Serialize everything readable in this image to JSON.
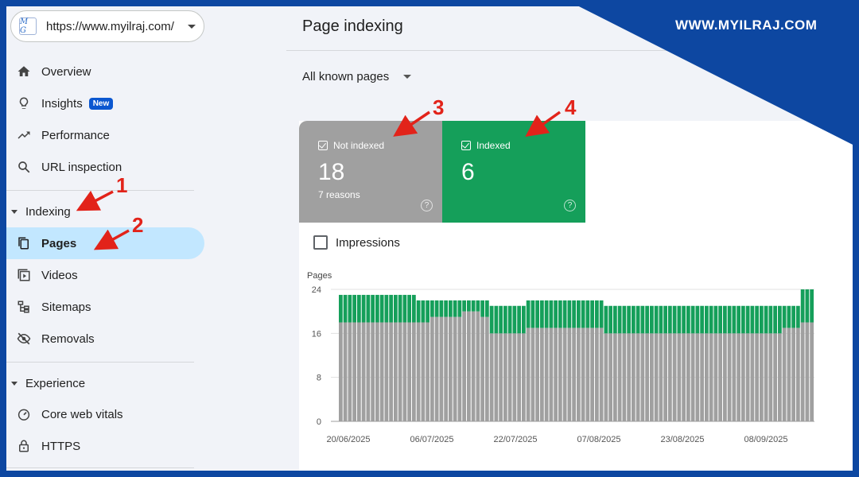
{
  "property": {
    "url": "https://www.myilraj.com/",
    "logo_text": "M G"
  },
  "sidebar": {
    "items_top": [
      {
        "label": "Overview",
        "icon": "home-icon"
      },
      {
        "label": "Insights",
        "icon": "lightbulb-icon",
        "badge": "New"
      },
      {
        "label": "Performance",
        "icon": "trending-up-icon"
      },
      {
        "label": "URL inspection",
        "icon": "search-icon"
      }
    ],
    "sections": [
      {
        "label": "Indexing",
        "items": [
          {
            "label": "Pages",
            "icon": "pages-icon",
            "active": true
          },
          {
            "label": "Videos",
            "icon": "video-icon"
          },
          {
            "label": "Sitemaps",
            "icon": "sitemap-icon"
          },
          {
            "label": "Removals",
            "icon": "eye-off-icon"
          }
        ]
      },
      {
        "label": "Experience",
        "items": [
          {
            "label": "Core web vitals",
            "icon": "speedometer-icon"
          },
          {
            "label": "HTTPS",
            "icon": "lock-icon"
          }
        ]
      }
    ]
  },
  "main": {
    "title": "Page indexing",
    "filter": "All known pages",
    "tiles": {
      "not_indexed": {
        "label": "Not indexed",
        "value": "18",
        "sub": "7 reasons"
      },
      "indexed": {
        "label": "Indexed",
        "value": "6"
      }
    },
    "impressions_label": "Impressions"
  },
  "banner": {
    "site": "WWW.MYILRAJ.COM",
    "color": "#0d47a1"
  },
  "annotations": [
    "1",
    "2",
    "3",
    "4"
  ],
  "colors": {
    "not_indexed": "#a0a0a0",
    "indexed": "#159f5a",
    "active_nav": "#c2e7ff",
    "badge": "#0b57d0"
  },
  "chart_data": {
    "type": "bar",
    "stacked": true,
    "ylabel": "Pages",
    "ylim": [
      0,
      24
    ],
    "yticks": [
      "0",
      "8",
      "16",
      "24"
    ],
    "xtick_labels": [
      "20/06/2025",
      "06/07/2025",
      "22/07/2025",
      "07/08/2025",
      "23/08/2025",
      "08/09/2025"
    ],
    "series": [
      {
        "name": "Not indexed",
        "values": [
          18,
          18,
          18,
          18,
          18,
          18,
          18,
          18,
          18,
          18,
          18,
          18,
          18,
          18,
          18,
          18,
          18,
          18,
          18,
          18,
          19,
          19,
          19,
          19,
          19,
          19,
          19,
          20,
          20,
          20,
          20,
          19,
          19,
          16,
          16,
          16,
          16,
          16,
          16,
          16,
          16,
          17,
          17,
          17,
          17,
          17,
          17,
          17,
          17,
          17,
          17,
          17,
          17,
          17,
          17,
          17,
          17,
          17,
          16,
          16,
          16,
          16,
          16,
          16,
          16,
          16,
          16,
          16,
          16,
          16,
          16,
          16,
          16,
          16,
          16,
          16,
          16,
          16,
          16,
          16,
          16,
          16,
          16,
          16,
          16,
          16,
          16,
          16,
          16,
          16,
          16,
          16,
          16,
          16,
          16,
          16,
          16,
          17,
          17,
          17,
          17,
          18,
          18,
          18
        ]
      },
      {
        "name": "Indexed",
        "values": [
          5,
          5,
          5,
          5,
          5,
          5,
          5,
          5,
          5,
          5,
          5,
          5,
          5,
          5,
          5,
          5,
          5,
          4,
          4,
          4,
          3,
          3,
          3,
          3,
          3,
          3,
          3,
          2,
          2,
          2,
          2,
          3,
          3,
          5,
          5,
          5,
          5,
          5,
          5,
          5,
          5,
          5,
          5,
          5,
          5,
          5,
          5,
          5,
          5,
          5,
          5,
          5,
          5,
          5,
          5,
          5,
          5,
          5,
          5,
          5,
          5,
          5,
          5,
          5,
          5,
          5,
          5,
          5,
          5,
          5,
          5,
          5,
          5,
          5,
          5,
          5,
          5,
          5,
          5,
          5,
          5,
          5,
          5,
          5,
          5,
          5,
          5,
          5,
          5,
          5,
          5,
          5,
          5,
          5,
          5,
          5,
          5,
          4,
          4,
          4,
          4,
          6,
          6,
          6
        ]
      }
    ]
  }
}
